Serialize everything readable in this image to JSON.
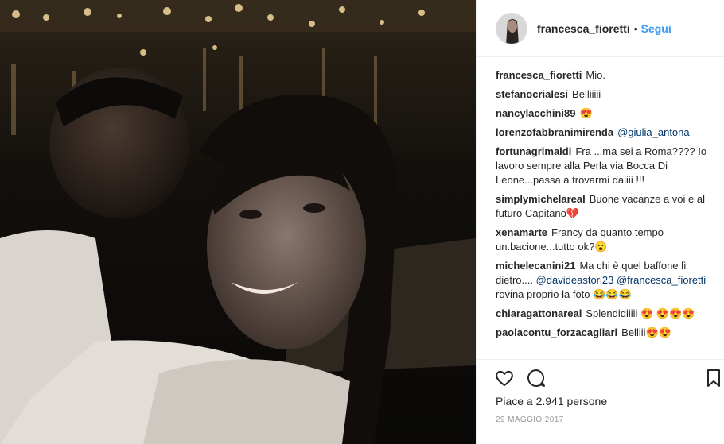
{
  "post": {
    "author": "francesca_fioretti",
    "follow_separator": "•",
    "follow_label": "Segui"
  },
  "comments": [
    {
      "user": "francesca_fioretti",
      "text": "Mio."
    },
    {
      "user": "stefanocrialesi",
      "text": "Belliiiii"
    },
    {
      "user": "nancylacchini89",
      "text": "😍"
    },
    {
      "user": "lorenzofabbranimirenda",
      "text": "",
      "mention": "@giulia_antona"
    },
    {
      "user": "fortunagrimaldi",
      "text": "Fra ...ma sei a Roma???? Io lavoro sempre alla Perla via Bocca Di Leone...passa a trovarmi daiiii !!!"
    },
    {
      "user": "simplymichelareal",
      "text": "Buone vacanze a voi e al futuro Capitano💔"
    },
    {
      "user": "xenamarte",
      "text": "Francy da quanto tempo un.bacione...tutto ok?😮"
    },
    {
      "user": "michelecanini21",
      "text": "Ma chi è quel baffone lì dietro....",
      "mention": "@davideastori23",
      "mention2": "@francesca_fioretti",
      "text2": "rovina proprio la foto 😂😂😂"
    },
    {
      "user": "chiaragattonareal",
      "text": "Splendidiiiii 😍 😍😍😍"
    },
    {
      "user": "paolacontu_forzacagliari",
      "text": "Belliii😍😍"
    }
  ],
  "actions": {
    "likes_text": "Piace a 2.941 persone",
    "date": "29 MAGGIO 2017"
  }
}
